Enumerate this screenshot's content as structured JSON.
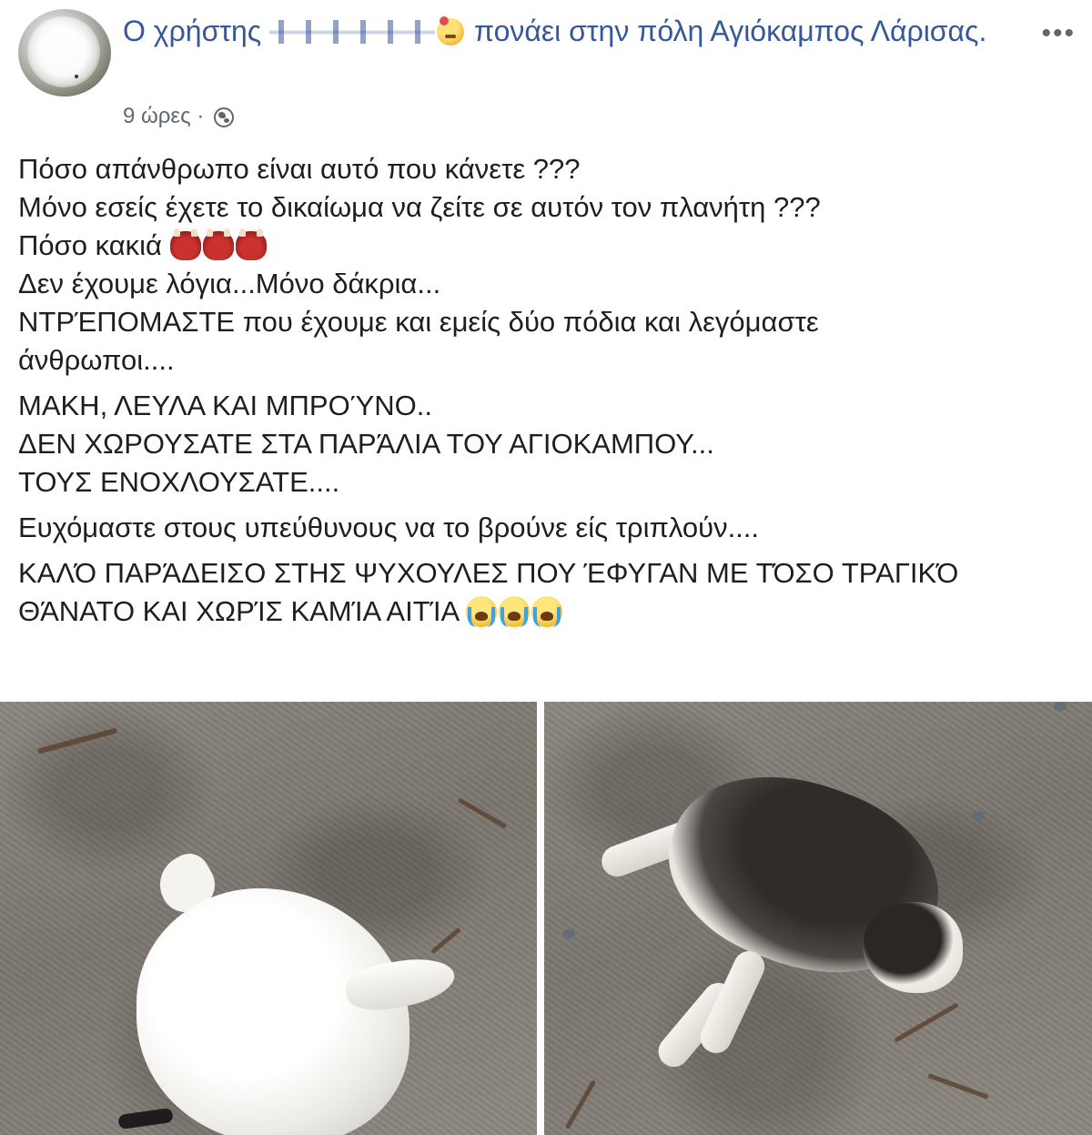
{
  "post": {
    "headline_prefix": "Ο χρήστης",
    "headline_suffix": "πονάει στην πόλη Αγιόκαμπος Λάρισας.",
    "feeling_icon": "hurt-face-emoji",
    "more_label": "•••",
    "time": "9 ώρες",
    "separator": "·",
    "privacy_icon": "globe-icon",
    "link_color": "#365899",
    "meta_color": "#616770",
    "text_color": "#1c1e21"
  },
  "body": {
    "paragraph1": {
      "line1": "Πόσο απάνθρωπο είναι αυτό που κάνετε ???",
      "line2": "Μόνο εσείς έχετε το δικαίωμα να ζείτε σε αυτόν τον πλανήτη ???",
      "line3": "Πόσο κακιά",
      "line3_emojis": [
        "ogre-emoji",
        "ogre-emoji",
        "ogre-emoji"
      ],
      "line4": "Δεν έχουμε λόγια...Μόνο δάκρια...",
      "line5": "ΝΤΡΈΠΟΜΑΣΤΕ που έχουμε και εμείς δύο πόδια και λεγόμαστε",
      "line6": "άνθρωποι...."
    },
    "paragraph2": {
      "line1": "ΜΑΚΗ, ΛΕΥΛΑ ΚΑΙ ΜΠΡΟΎΝΟ..",
      "line2": "ΔΕΝ ΧΩΡΟΥΣΑΤΕ ΣΤΑ ΠΑΡΆΛΙΑ ΤΟΥ ΑΓΙΟΚΑΜΠΟΥ...",
      "line3": "ΤΟΥΣ ΕΝΟΧΛΟΥΣΑΤΕ...."
    },
    "paragraph3": {
      "line1": "Ευχόμαστε στους υπεύθυνους να το βρούνε είς τριπλούν...."
    },
    "paragraph4": {
      "line1": "ΚΑΛΌ ΠΑΡΆΔΕΙΣΟ ΣΤΗΣ ΨΥΧΟΥΛΕΣ ΠΟΥ ΈΦΥΓΑΝ ΜΕ ΤΌΣΟ ΤΡΑΓΙΚΌ",
      "line2": "ΘΆΝΑΤΟ ΚΑΙ ΧΩΡΊΣ ΚΑΜΊΑ ΑΙΤΊΑ",
      "line2_emojis": [
        "crying-face-emoji",
        "crying-face-emoji",
        "crying-face-emoji"
      ]
    }
  }
}
